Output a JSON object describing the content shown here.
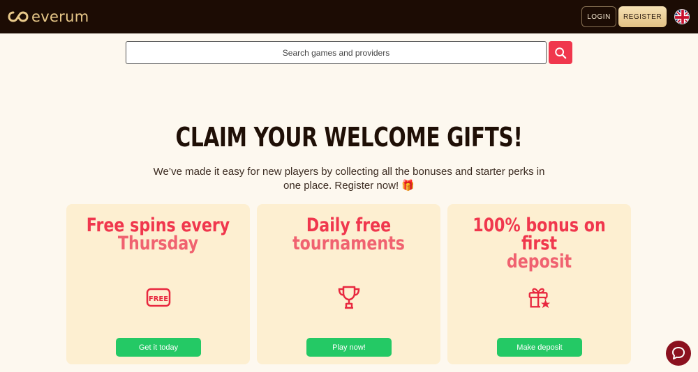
{
  "header": {
    "logo_text": "everum",
    "login_label": "LOGIN",
    "register_label": "REGISTER",
    "language_icon": "uk-flag-icon"
  },
  "search": {
    "placeholder": "Search games and providers",
    "button_icon": "search-icon"
  },
  "hero": {
    "title": "CLAIM YOUR WELCOME GIFTS!",
    "subtitle": "We’ve made it easy for new players by collecting all the bonuses and starter perks in one place. Register now! 🎁"
  },
  "cards": [
    {
      "title_line1": "Free spins every",
      "title_line2": "Thursday",
      "icon": "free-badge-icon",
      "button_label": "Get it today"
    },
    {
      "title_line1": "Daily free",
      "title_line2": "tournaments",
      "icon": "trophy-icon",
      "button_label": "Play now!"
    },
    {
      "title_line1": "100% bonus on first",
      "title_line2": "deposit",
      "icon": "gift-star-icon",
      "button_label": "Make deposit"
    }
  ],
  "chat": {
    "icon": "chat-icon"
  },
  "colors": {
    "header_bg": "#1c0c04",
    "accent_red": "#f0374d",
    "cta_green": "#24c965",
    "card_bg": "#fdefd1",
    "gold": "#e8c98a"
  }
}
